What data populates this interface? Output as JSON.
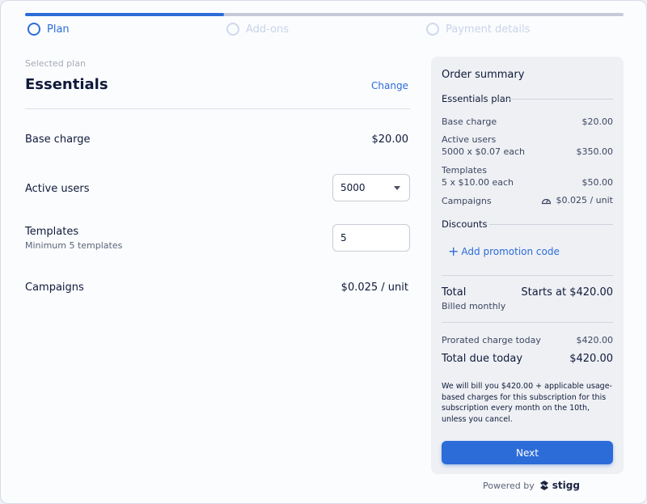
{
  "stepper": {
    "progress_fraction": 0.333,
    "steps": [
      {
        "label": "Plan",
        "state": "active"
      },
      {
        "label": "Add-ons",
        "state": "inactive"
      },
      {
        "label": "Payment details",
        "state": "inactive"
      }
    ]
  },
  "plan": {
    "caption": "Selected plan",
    "name": "Essentials",
    "change_label": "Change"
  },
  "rows": {
    "base_charge": {
      "label": "Base charge",
      "value": "$20.00"
    },
    "active_users": {
      "label": "Active users",
      "selected": "5000"
    },
    "templates": {
      "label": "Templates",
      "sub": "Minimum 5 templates",
      "value": "5"
    },
    "campaigns": {
      "label": "Campaigns",
      "value": "$0.025 / unit"
    }
  },
  "summary": {
    "title": "Order summary",
    "plan_section": "Essentials plan",
    "lines": {
      "base_charge": {
        "label": "Base charge",
        "value": "$20.00"
      },
      "active_users": {
        "label": "Active users",
        "detail": "5000 x $0.07 each",
        "value": "$350.00"
      },
      "templates": {
        "label": "Templates",
        "detail": "5 x $10.00 each",
        "value": "$50.00"
      },
      "campaigns": {
        "label": "Campaigns",
        "value": "$0.025 / unit"
      }
    },
    "discounts_section": "Discounts",
    "promo_label": "Add promotion code",
    "total": {
      "label": "Total",
      "value": "Starts at $420.00",
      "billing": "Billed monthly"
    },
    "prorated": {
      "label": "Prorated charge today",
      "value": "$420.00"
    },
    "due_today": {
      "label": "Total due today",
      "value": "$420.00"
    },
    "note": "We will bill you $420.00 + applicable usage-based charges for this subscription for this subscription every month on the 10th, unless you cancel.",
    "next_label": "Next"
  },
  "footer": {
    "powered_by": "Powered by",
    "brand": "stigg"
  },
  "colors": {
    "accent": "#2c6cd9",
    "text": "#0f1a3a",
    "card": "#eef0f4"
  },
  "icons": {
    "step": "radio-circle-icon",
    "dropdown": "caret-down-icon",
    "plus": "plus-icon",
    "meter": "gauge-icon",
    "brand": "stigg-logo-icon"
  }
}
